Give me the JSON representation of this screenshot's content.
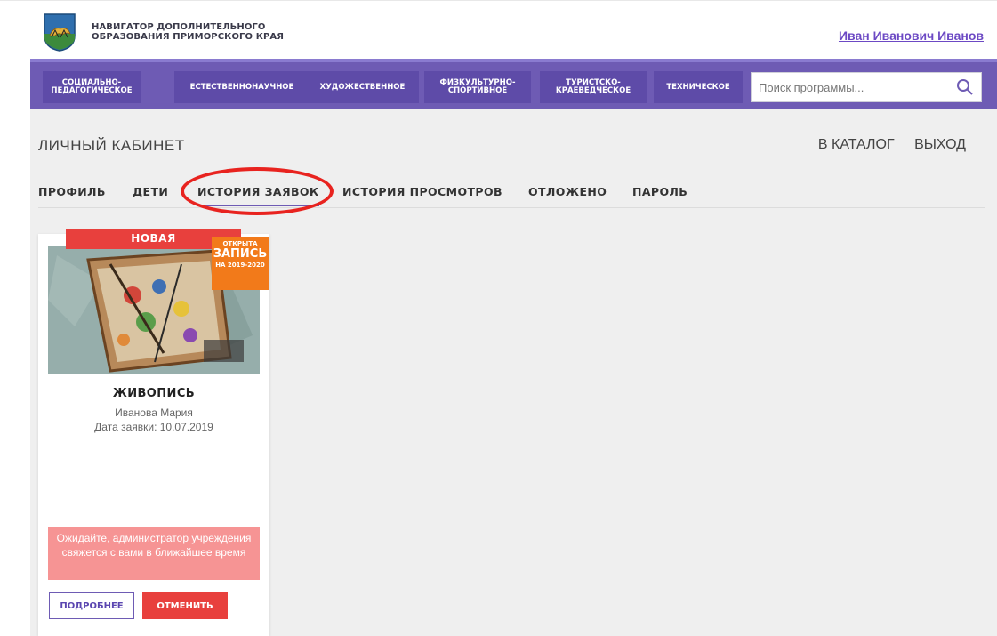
{
  "header": {
    "brand_line1": "НАВИГАТОР ДОПОЛНИТЕЛЬНОГО",
    "brand_line2": "ОБРАЗОВАНИЯ ПРИМОРСКОГО КРАЯ",
    "user_name": "Иван Иванович Иванов"
  },
  "nav": {
    "items": [
      {
        "label": "СОЦИАЛЬНО-\nПЕДАГОГИЧЕСКОЕ"
      },
      {
        "label": "ЕСТЕСТВЕННОНАУЧНОЕ"
      },
      {
        "label": "ХУДОЖЕСТВЕННОЕ"
      },
      {
        "label": "ФИЗКУЛЬТУРНО-\nСПОРТИВНОЕ"
      },
      {
        "label": "ТУРИСТСКО-\nКРАЕВЕДЧЕСКОЕ"
      },
      {
        "label": "ТЕХНИЧЕСКОЕ"
      }
    ],
    "search_placeholder": "Поиск программы..."
  },
  "main": {
    "title": "ЛИЧНЫЙ КАБИНЕТ",
    "catalog_link": "В КАТАЛОГ",
    "logout_link": "ВЫХОД",
    "tabs": [
      {
        "label": "ПРОФИЛЬ"
      },
      {
        "label": "ДЕТИ"
      },
      {
        "label": "ИСТОРИЯ ЗАЯВОК",
        "active": true
      },
      {
        "label": "ИСТОРИЯ ПРОСМОТРОВ"
      },
      {
        "label": "ОТЛОЖЕНО"
      },
      {
        "label": "ПАРОЛЬ"
      }
    ]
  },
  "card": {
    "status_badge": "НОВАЯ",
    "open_badge": {
      "line1": "ОТКРЫТА",
      "line2": "ЗАПИСЬ",
      "line3": "НА 2019-2020"
    },
    "title": "ЖИВОПИСЬ",
    "child_name": "Иванова Мария",
    "date_text": "Дата заявки: 10.07.2019",
    "notice": "Ожидайте, администратор учреждения свяжется с вами в ближайшее время",
    "details_button": "ПОДРОБНЕЕ",
    "cancel_button": "ОТМЕНИТЬ"
  },
  "colors": {
    "accent": "#6e5bb4",
    "danger": "#e8403d",
    "notice_bg": "#f69494",
    "badge_orange": "#f27a1a",
    "highlight_circle": "#e8231f"
  },
  "icons": {
    "logo": "coat-of-arms-icon",
    "search": "search-icon"
  }
}
